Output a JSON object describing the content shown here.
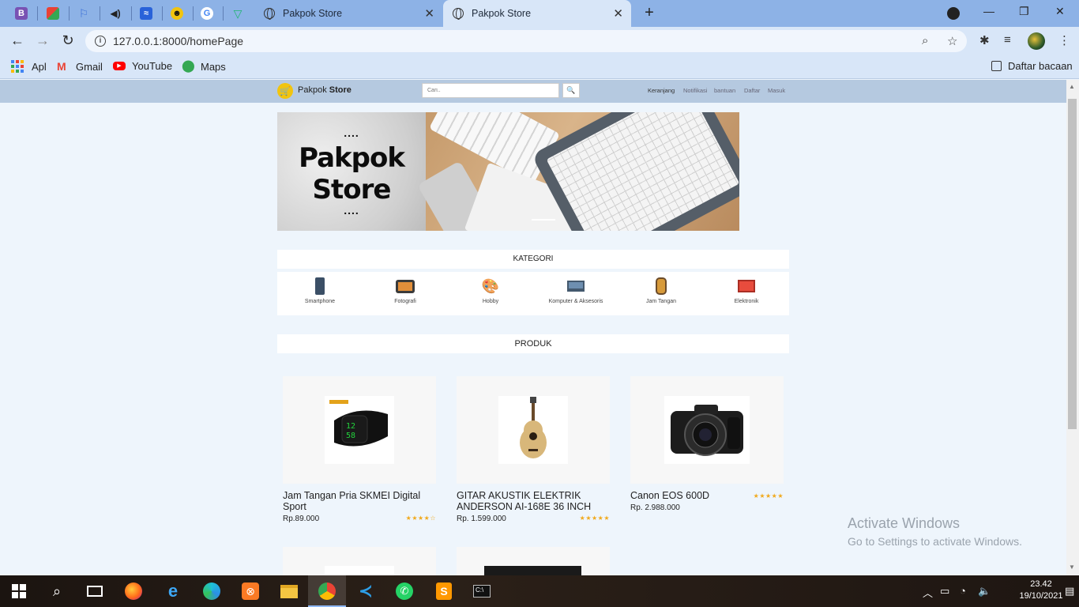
{
  "browser": {
    "tabs": [
      {
        "title": "Pakpok Store",
        "active": false
      },
      {
        "title": "Pakpok Store",
        "active": true
      }
    ],
    "address": "127.0.0.1:8000/homePage",
    "bookmarks": [
      {
        "label": "Apl",
        "icon": "apps-grid-icon"
      },
      {
        "label": "Gmail",
        "icon": "gmail-icon"
      },
      {
        "label": "YouTube",
        "icon": "youtube-icon"
      },
      {
        "label": "Maps",
        "icon": "maps-icon"
      }
    ],
    "reading_list": "Daftar bacaan",
    "accent": "#8db2e6"
  },
  "header": {
    "brand_light": "Pakpok",
    "brand_bold": "Store",
    "search_placeholder": "Cari..",
    "nav": [
      "Keranjang",
      "Notifikasi",
      "bantuan",
      "Daftar",
      "Masuk"
    ]
  },
  "banner": {
    "line1": "Pakpok",
    "line2": "Store",
    "dots": "....",
    "dots_bottom": "...."
  },
  "kategori": {
    "title": "KATEGORI",
    "items": [
      {
        "label": "Smartphone",
        "icon": "smartphone-icon"
      },
      {
        "label": "Fotografi",
        "icon": "camera-icon"
      },
      {
        "label": "Hobby",
        "icon": "palette-icon"
      },
      {
        "label": "Komputer & Aksesoris",
        "icon": "laptop-icon"
      },
      {
        "label": "Jam Tangan",
        "icon": "watch-icon"
      },
      {
        "label": "Elektronik",
        "icon": "monitor-icon"
      }
    ]
  },
  "produk": {
    "title": "PRODUK",
    "items": [
      {
        "name": "Jam Tangan Pria SKMEI Digital Sport",
        "price": "Rp.89.000",
        "rating": 4,
        "stars": "★★★★☆",
        "image": "digital-watch-image"
      },
      {
        "name": "GITAR AKUSTIK ELEKTRIK ANDERSON AI-168E 36 INCH",
        "price": "Rp. 1.599.000",
        "rating": 5,
        "stars": "★★★★★",
        "image": "guitar-image"
      },
      {
        "name": "Canon EOS 600D",
        "price": "Rp. 2.988.000",
        "rating": 5,
        "stars": "★★★★★",
        "image": "camera-image"
      }
    ]
  },
  "watermark": {
    "line1": "Activate Windows",
    "line2": "Go to Settings to activate Windows."
  },
  "taskbar": {
    "time": "23.42",
    "date": "19/10/2021"
  }
}
